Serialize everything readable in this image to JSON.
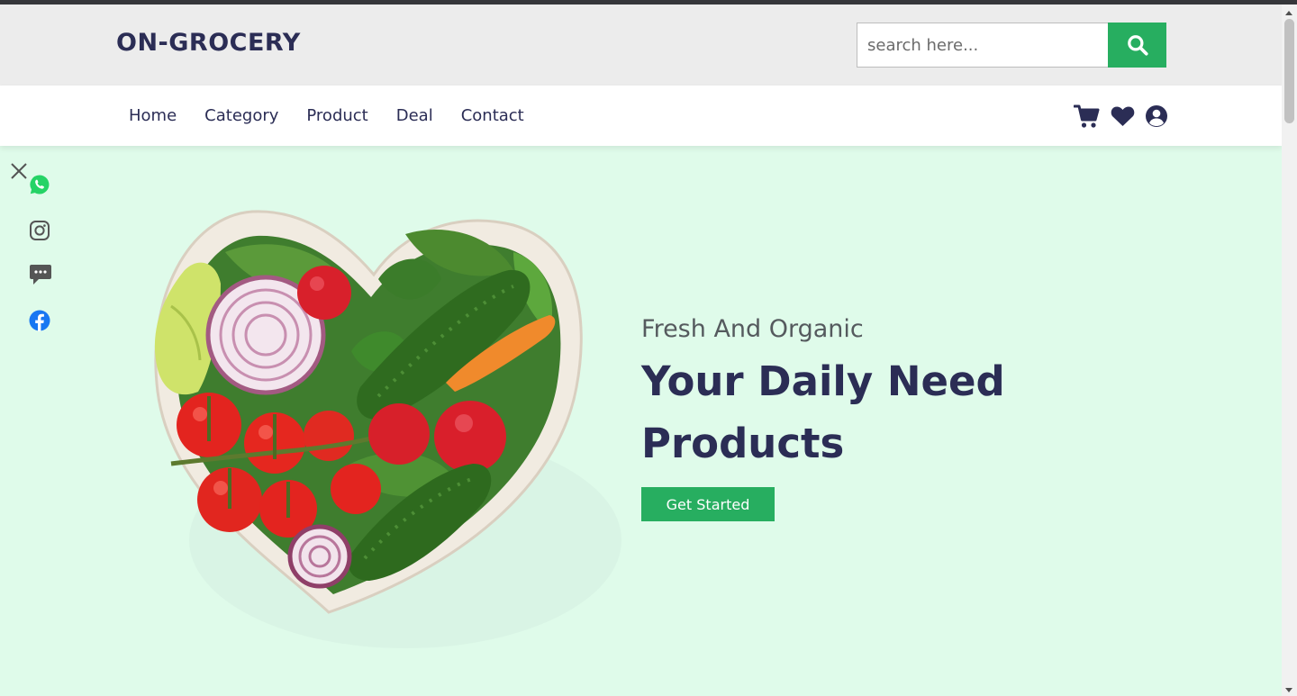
{
  "brand": {
    "logo_text": "ON-GROCERY",
    "accent_color": "#27ae60",
    "text_color": "#2b2d55",
    "hero_bg": "#dffbea"
  },
  "search": {
    "placeholder": "search here...",
    "value": "",
    "icon": "search-icon"
  },
  "nav": {
    "links": [
      "Home",
      "Category",
      "Product",
      "Deal",
      "Contact"
    ],
    "icons": [
      "cart-icon",
      "heart-icon",
      "user-icon"
    ]
  },
  "social": {
    "close_icon": "close-icon",
    "icons": [
      "whatsapp-icon",
      "instagram-icon",
      "sms-icon",
      "facebook-icon"
    ],
    "colors": {
      "whatsapp": "#25d366",
      "facebook": "#1877f2",
      "neutral": "#555555"
    }
  },
  "hero": {
    "subtitle": "Fresh And Organic",
    "title": "Your Daily Need Products",
    "cta_label": "Get Started",
    "image": "heart-shaped-vegetable-bowl"
  }
}
